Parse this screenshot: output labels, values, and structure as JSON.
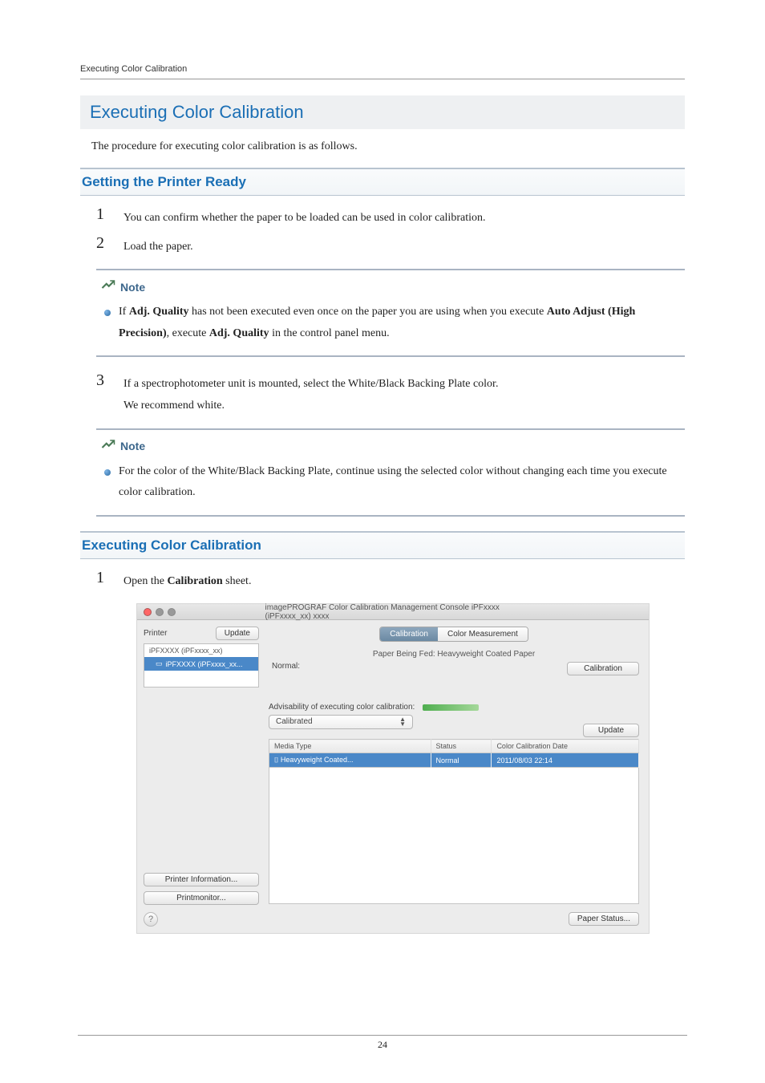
{
  "page_header": "Executing Color Calibration",
  "title": "Executing Color Calibration",
  "intro": "The procedure for executing color calibration is as follows.",
  "section1": {
    "heading": "Getting the Printer Ready",
    "item1": "You can confirm whether the paper to be loaded can be used in color calibration.",
    "item2": "Load the paper.",
    "note1_label": "Note",
    "note1_text_pre": "If ",
    "note1_bold1": "Adj. Quality",
    "note1_text_mid": " has not been executed even once on the paper you are using when you execute ",
    "note1_bold2": "Auto Adjust (High Precision)",
    "note1_text_mid2": ", execute ",
    "note1_bold3": "Adj. Quality",
    "note1_text_end": " in the control panel menu.",
    "item3_line1": "If a spectrophotometer unit is mounted, select the White/Black Backing Plate color.",
    "item3_line2": "We recommend white.",
    "note2_label": "Note",
    "note2_text": "For the color of the White/Black Backing Plate, continue using the selected color without changing each time you execute color calibration."
  },
  "section2": {
    "heading": "Executing Color Calibration",
    "item1_pre": "Open the ",
    "item1_bold": "Calibration",
    "item1_post": " sheet."
  },
  "screenshot": {
    "window_title": "imagePROGRAF Color Calibration Management Console iPFxxxx (iPFxxxx_xx) xxxx",
    "left": {
      "printer_label": "Printer",
      "update_btn": "Update",
      "list_item1": "iPFXXXX (iPFxxxx_xx)",
      "list_item2": "iPFXXXX (iPFxxxx_xx...",
      "printer_info_btn": "Printer Information...",
      "printmonitor_btn": "Printmonitor..."
    },
    "right": {
      "tab_calibration": "Calibration",
      "tab_colormeasurement": "Color Measurement",
      "paper_fed": "Paper Being Fed: Heavyweight Coated Paper",
      "normal_label": "Normal:",
      "calibration_btn": "Calibration",
      "advisability_label": "Advisability of executing color calibration:",
      "combo_value": "Calibrated",
      "update_btn": "Update",
      "col_media": "Media Type",
      "col_status": "Status",
      "col_date": "Color Calibration Date",
      "row_media": "Heavyweight Coated...",
      "row_status": "Normal",
      "row_date": "2011/08/03 22:14",
      "paper_status_btn": "Paper Status..."
    }
  },
  "page_number": "24"
}
